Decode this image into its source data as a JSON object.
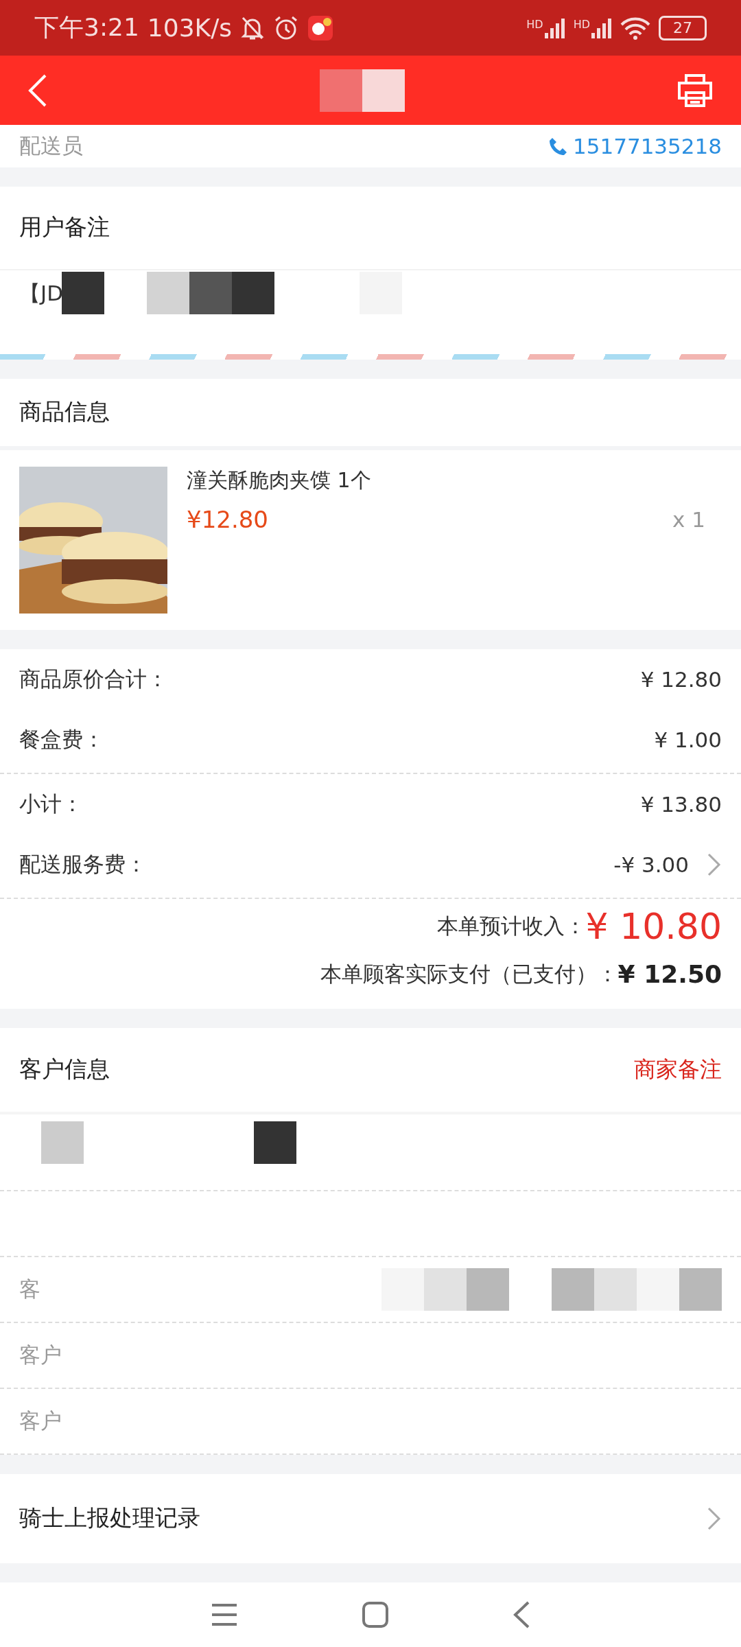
{
  "status_bar": {
    "time": "下午3:21",
    "speed": "103K/s",
    "signals": [
      "HD",
      "HD"
    ],
    "battery": "27"
  },
  "courier": {
    "label": "配送员",
    "phone": "15177135218"
  },
  "user_note": {
    "title": "用户备注",
    "text": "【JD"
  },
  "goods": {
    "title": "商品信息",
    "items": [
      {
        "name": "潼关酥脆肉夹馍 1个",
        "price": "¥12.80",
        "quantity": "x 1"
      }
    ]
  },
  "fee_groups": [
    [
      {
        "label": "商品原价合计：",
        "value": "¥ 12.80",
        "kind": "plain"
      },
      {
        "label": "餐盒费：",
        "value": "¥ 1.00",
        "kind": "plain"
      }
    ],
    [
      {
        "label": "小计：",
        "value": "¥ 13.80",
        "kind": "plain"
      },
      {
        "label": "配送服务费：",
        "value": "-¥ 3.00",
        "kind": "link"
      }
    ]
  ],
  "summary": [
    {
      "label": "本单预计收入：",
      "value": "¥ 10.80",
      "kind": "highlight"
    },
    {
      "label": "本单顾客实际支付（已支付）：",
      "value": "¥ 12.50",
      "kind": "plain"
    }
  ],
  "customer": {
    "title": "客户信息",
    "action": "商家备注",
    "rows": [
      "客",
      "客户",
      "客户"
    ]
  },
  "rider_report": {
    "label": "骑士上报处理记录"
  }
}
